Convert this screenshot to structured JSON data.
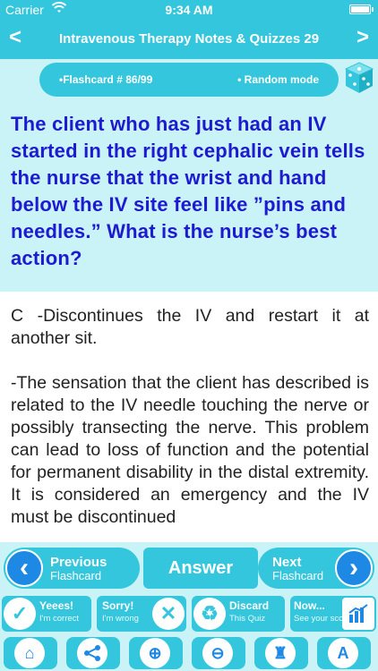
{
  "status_bar": {
    "carrier": "Carrier",
    "time": "9:34 AM"
  },
  "nav": {
    "title": "Intravenous Therapy Notes & Quizzes 29",
    "back_glyph": "<",
    "forward_glyph": ">"
  },
  "info": {
    "flashcard": "•Flashcard #  86/99",
    "mode": "• Random mode"
  },
  "question": "The client who has just had an IV started in the right cephalic vein tells the nurse that the wrist and hand below the IV site feel like ”pins and needles.” What is the nurse’s best action?",
  "answer": "C -Discontinues the IV and restart it at another sit.\n\n-The sensation that the client has described is related to the IV needle touching the nerve or possibly transecting the nerve. This problem can lead to loss of function and the potential for permanent disability in the distal extremity. It is considered an emergency and the IV must be discontinued",
  "controls": {
    "previous_title": "Previous",
    "previous_sub": "Flashcard",
    "answer_label": "Answer",
    "next_title": "Next",
    "next_sub": "Flashcard",
    "yes_title": "Yeees!",
    "yes_sub": "I'm correct",
    "sorry_title": "Sorry!",
    "sorry_sub": "I'm wrong",
    "discard_title": "Discard",
    "discard_sub": "This Quiz",
    "now_title": "Now...",
    "now_sub": "See your score"
  },
  "colors": {
    "primary": "#34c6dc",
    "light": "#c9f3f6",
    "question_text": "#1d1ad0",
    "accent_blue": "#1e88e5"
  }
}
